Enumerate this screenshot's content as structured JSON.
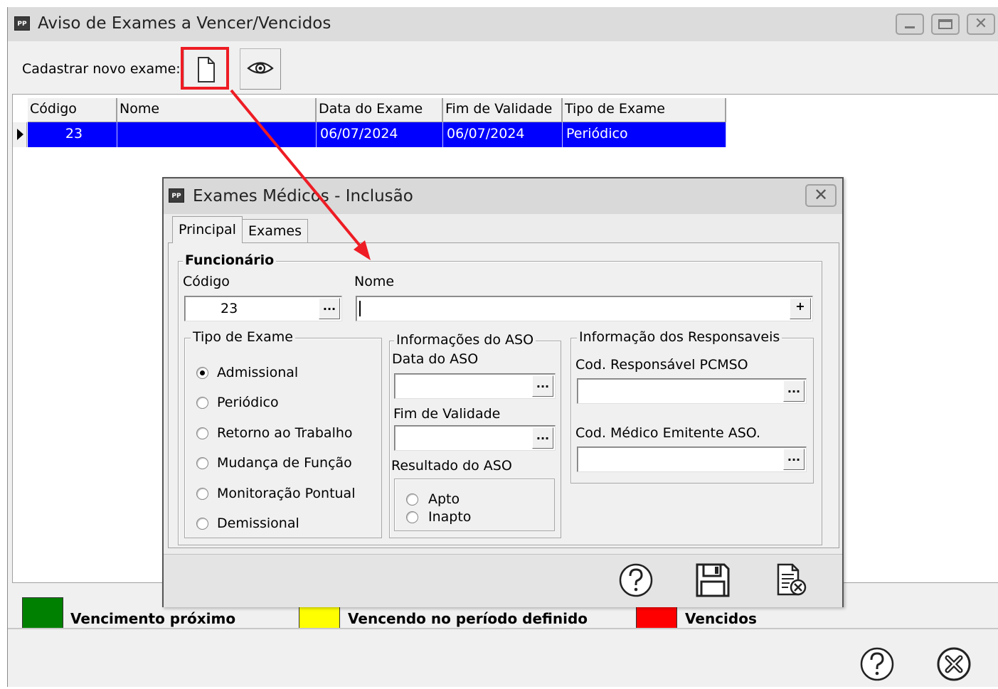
{
  "main_window": {
    "app_icon": "PP",
    "title": "Aviso de Exames a Vencer/Vencidos",
    "window_buttons": [
      "minimize-icon",
      "maximize-icon",
      "close-icon"
    ]
  },
  "toolbar": {
    "label": "Cadastrar novo exame:",
    "new_exam_icon": "new-document-icon",
    "view_icon": "eye-icon"
  },
  "grid": {
    "columns": [
      "Código",
      "Nome",
      "Data do Exame",
      "Fim de Validade",
      "Tipo de Exame"
    ],
    "rows": [
      {
        "codigo": "23",
        "nome": "",
        "data_exame": "06/07/2024",
        "fim_validade": "06/07/2024",
        "tipo_exame": "Periódico"
      }
    ]
  },
  "legend": [
    {
      "label": "Vencimento próximo",
      "color": "#008000"
    },
    {
      "label": "Vencendo no período definido",
      "color": "#ffff00"
    },
    {
      "label": "Vencidos",
      "color": "#ff0000"
    }
  ],
  "footer_icons": [
    "help-icon",
    "close-circle-icon"
  ],
  "dialog": {
    "app_icon": "PP",
    "title": "Exames Médicos - Inclusão",
    "tabs": [
      "Principal",
      "Exames"
    ],
    "funcionario": {
      "caption": "Funcionário",
      "codigo_label": "Código",
      "codigo_value": "23",
      "nome_label": "Nome",
      "nome_value": "",
      "lookup_btn": "...",
      "add_btn": "+"
    },
    "tipo_exame": {
      "caption": "Tipo de Exame",
      "options": [
        "Admissional",
        "Periódico",
        "Retorno ao Trabalho",
        "Mudança de Função",
        "Monitoração Pontual",
        "Demissional"
      ],
      "selected": "Admissional"
    },
    "aso": {
      "caption": "Informações do ASO",
      "data_label": "Data do ASO",
      "data_value": "",
      "fim_label": "Fim de Validade",
      "fim_value": "",
      "resultado_label": "Resultado do ASO",
      "resultado_options": [
        "Apto",
        "Inapto"
      ]
    },
    "responsaveis": {
      "caption": "Informação dos Responsaveis",
      "pcmso_label": "Cod. Responsável PCMSO",
      "pcmso_value": "",
      "medico_label": "Cod. Médico Emitente ASO.",
      "medico_value": ""
    },
    "footer_icons": [
      "help-icon",
      "save-icon",
      "cancel-document-icon"
    ]
  },
  "annotation_color": "#ee1c24"
}
